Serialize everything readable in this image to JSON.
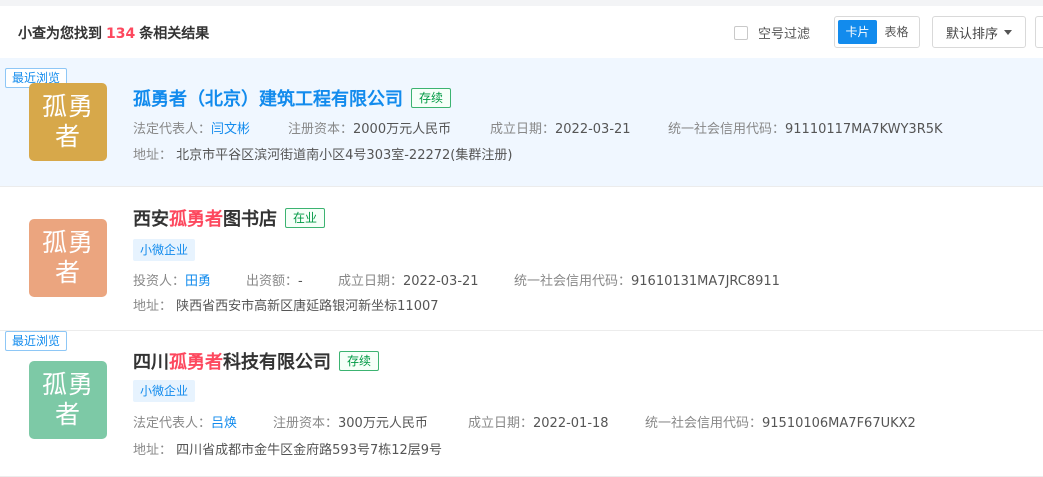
{
  "header": {
    "summary_prefix": "小查为您找到",
    "count": "134",
    "summary_suffix": "条相关结果",
    "filter_label": "空号过滤",
    "view_card": "卡片",
    "view_table": "表格",
    "sort_label": "默认排序"
  },
  "recent_label": "最近浏览",
  "results": [
    {
      "logo_line1": "孤勇",
      "logo_line2": "者",
      "logo_color": "#d7a84a",
      "name": "孤勇者（北京）建筑工程有限公司",
      "status": "存续",
      "fields": [
        {
          "label": "法定代表人：",
          "value": "闫文彬"
        },
        {
          "label": "注册资本：",
          "value": "2000万元人民币"
        },
        {
          "label": "成立日期：",
          "value": "2022-03-21"
        },
        {
          "label": "统一社会信用代码：",
          "value": "91110117MA7KWY3R5K"
        }
      ],
      "address_label": "地址：",
      "address": "北京市平谷区滨河街道南小区4号303室-22272(集群注册)"
    },
    {
      "logo_line1": "孤勇",
      "logo_line2": "者",
      "logo_color": "#eba57f",
      "name_pre": "西安",
      "name_hl": "孤勇者",
      "name_post": "图书店",
      "status": "在业",
      "tag": "小微企业",
      "fields": [
        {
          "label": "投资人：",
          "value": "田勇"
        },
        {
          "label": "出资额：",
          "value": "-"
        },
        {
          "label": "成立日期：",
          "value": "2022-03-21"
        },
        {
          "label": "统一社会信用代码：",
          "value": "91610131MA7JRC8911"
        }
      ],
      "address_label": "地址：",
      "address": "陕西省西安市高新区唐延路银河新坐标11007"
    },
    {
      "logo_line1": "孤勇",
      "logo_line2": "者",
      "logo_color": "#7dc9a6",
      "name_pre": "四川",
      "name_hl": "孤勇者",
      "name_post": "科技有限公司",
      "status": "存续",
      "tag": "小微企业",
      "fields": [
        {
          "label": "法定代表人：",
          "value": "吕焕"
        },
        {
          "label": "注册资本：",
          "value": "300万元人民币"
        },
        {
          "label": "成立日期：",
          "value": "2022-01-18"
        },
        {
          "label": "统一社会信用代码：",
          "value": "91510106MA7F67UKX2"
        }
      ],
      "address_label": "地址：",
      "address": "四川省成都市金牛区金府路593号7栋12层9号"
    }
  ]
}
